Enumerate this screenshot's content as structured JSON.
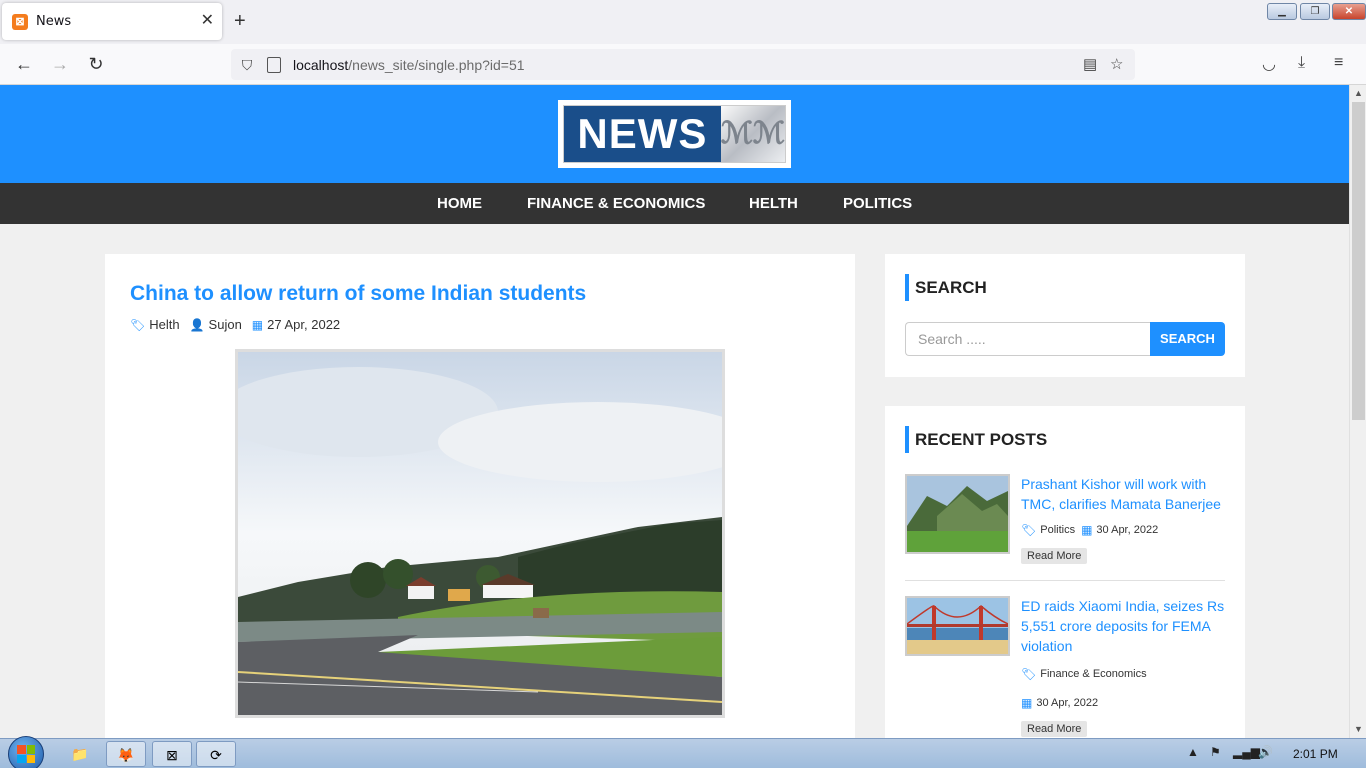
{
  "browser": {
    "tab_title": "News",
    "tab_favicon_letter": "⊠",
    "new_tab": "+",
    "url_host": "localhost",
    "url_path": "/news_site/single.php?id=51",
    "window_controls": {
      "minimize": "▁",
      "restore": "❐",
      "close": "✕"
    }
  },
  "site": {
    "logo_text": "NEWS",
    "logo_mark": "ℳℳ",
    "menu": [
      "HOME",
      "FINANCE & ECONOMICS",
      "HELTH",
      "POLITICS"
    ],
    "accent": "#1e90ff",
    "menu_bg": "#333333"
  },
  "post": {
    "title": "China to allow return of some Indian students",
    "category": "Helth",
    "author": "Sujon",
    "date": "27 Apr, 2022"
  },
  "sidebar": {
    "search_title": "SEARCH",
    "search_placeholder": "Search .....",
    "search_button": "SEARCH",
    "recent_title": "RECENT POSTS",
    "recent_posts": [
      {
        "title": "Prashant Kishor will work with TMC, clarifies Mamata Banerjee",
        "category": "Politics",
        "date": "30 Apr, 2022",
        "read_more": "Read More"
      },
      {
        "title": "ED raids Xiaomi India, seizes Rs 5,551 crore deposits for FEMA violation",
        "category": "Finance & Economics",
        "date": "30 Apr, 2022",
        "read_more": "Read More"
      }
    ]
  },
  "taskbar": {
    "clock": "2:01 PM"
  }
}
